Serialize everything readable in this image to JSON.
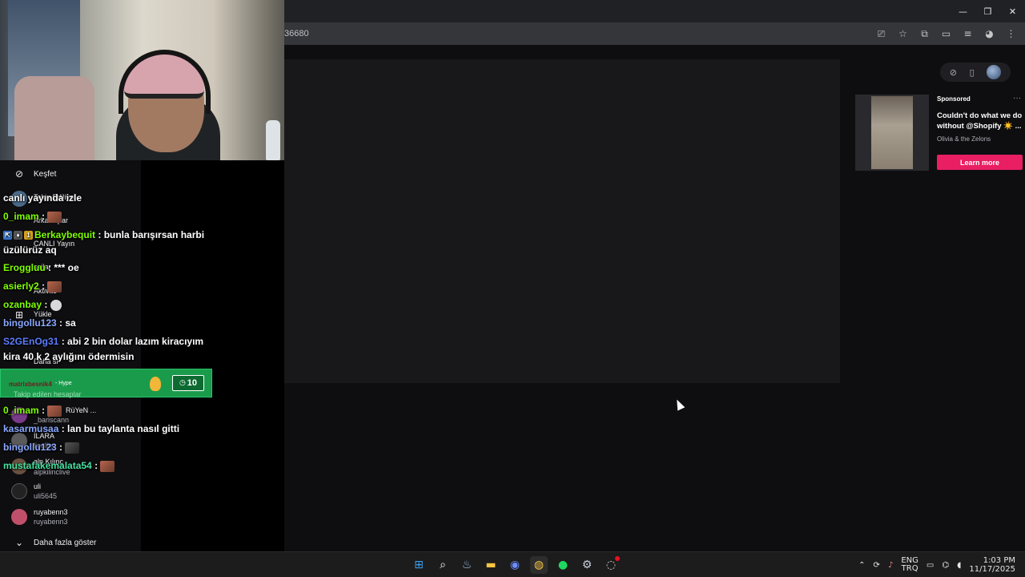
{
  "browser": {
    "url_fragment": "36680",
    "controls": {
      "minimize": "—",
      "restore": "❐",
      "close": "✕"
    }
  },
  "sidebar": {
    "kesfet": "Keşfet",
    "items_garbled": [
      {
        "text": "Takip Ediliyor"
      },
      {
        "text": "Arkadaşlar"
      },
      {
        "text": "CANLI Yayın"
      },
      {
        "text": "sajlar"
      },
      {
        "text": "Aktivite"
      },
      {
        "text": "Yükle"
      },
      {
        "text": "Daha si"
      }
    ],
    "followed_header": "Takip edilen hesaplar",
    "channels": [
      {
        "name": "RüYeN ...",
        "login": "_bariscann"
      },
      {
        "name": "İLARA",
        "login": "lionline"
      },
      {
        "name": "alp Kılınç",
        "login": "alpkilinclive"
      },
      {
        "name": "uli",
        "login": "uli5645"
      },
      {
        "name": "ruyabenn3",
        "login": "ruyabenn3"
      }
    ],
    "show_more": "Daha fazla göster"
  },
  "chat": [
    {
      "user": "",
      "color": "#ffffff",
      "text": "canlı yayında izle"
    },
    {
      "user": "0_imam",
      "color": "#7fff00",
      "text": " :",
      "emote": "pepe"
    },
    {
      "user": "Berkaybequit",
      "color": "#7fff00",
      "text": " : bunla barışırsan harbi"
    },
    {
      "user": "",
      "color": "#ffffff",
      "text": "üzülürüz aq"
    },
    {
      "user": "Eroggluu",
      "color": "#7fff00",
      "text": " : *** oe"
    },
    {
      "user": "asierly2",
      "color": "#7fff00",
      "text": " :",
      "emote": "pepe"
    },
    {
      "user": "ozanbay",
      "color": "#7fff00",
      "text": " :",
      "emote": "skull"
    },
    {
      "user": "bingollu123",
      "color": "#8aa8ff",
      "text": " : sa"
    },
    {
      "user": "S2GEnOg31",
      "color": "#5b7dff",
      "text": " : abi 2 bin dolar lazım kiracıyım"
    },
    {
      "user": "",
      "color": "#ffffff",
      "text": "kira 40 k 2 aylığını ödermisin"
    },
    {
      "user": "0_imam",
      "color": "#7fff00",
      "text": " :",
      "emote": "pepe"
    },
    {
      "user": "kasarmusaa",
      "color": "#8aa8ff",
      "text": " : lan bu taylanta nasıl gitti"
    },
    {
      "user": "bingollu123",
      "color": "#8aa8ff",
      "text": " :",
      "emote": "dark"
    },
    {
      "user": "mustafakemalata54",
      "color": "#46e0a0",
      "text": " :",
      "emote": "pepe"
    }
  ],
  "hype": {
    "who": "matrixbesnik4",
    "label": "- Hype",
    "count": "10"
  },
  "topright": {
    "compass": "⊘",
    "phone": "▯"
  },
  "ad": {
    "sponsored": "Sponsored",
    "dots": "···",
    "headline": "Couldn't do what we do without @Shopify ☀️ ...",
    "sub": "Olivia & the Zelons",
    "button": "Learn more"
  },
  "taskbar": {
    "apps": [
      {
        "name": "windows-start-icon",
        "glyph": "⊞",
        "color": "#3aa0f0"
      },
      {
        "name": "search-icon",
        "glyph": "⌕",
        "color": "#ffffff"
      },
      {
        "name": "steam-icon",
        "glyph": "♨",
        "color": "#9fc6ea"
      },
      {
        "name": "file-explorer-icon",
        "glyph": "▬",
        "color": "#f6c445"
      },
      {
        "name": "app-icon",
        "glyph": "◉",
        "color": "#6b8cff"
      },
      {
        "name": "chrome-icon",
        "glyph": "◍",
        "color": "#f4c542"
      },
      {
        "name": "spotify-icon",
        "glyph": "●",
        "color": "#1ed760"
      },
      {
        "name": "settings-icon",
        "glyph": "⚙",
        "color": "#c9d1e0"
      },
      {
        "name": "notification-app-icon",
        "glyph": "◌",
        "color": "#d0d0d0"
      }
    ],
    "lang_top": "ENG",
    "lang_bottom": "TRQ",
    "time": "1:03 PM",
    "date": "11/17/2025"
  }
}
